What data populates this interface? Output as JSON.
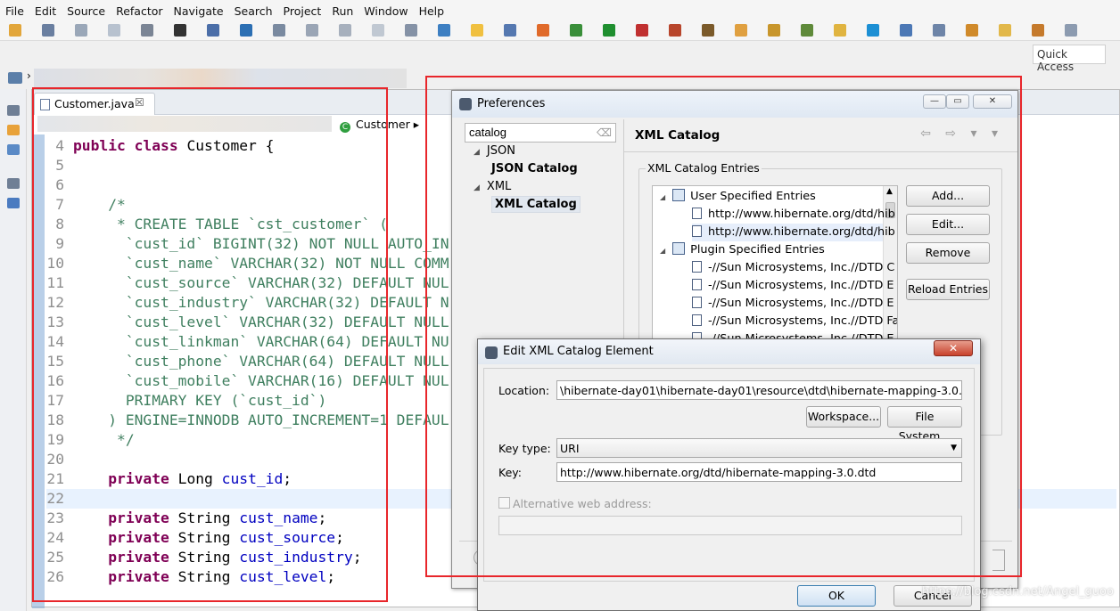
{
  "menubar": [
    "File",
    "Edit",
    "Source",
    "Refactor",
    "Navigate",
    "Search",
    "Project",
    "Run",
    "Window",
    "Help"
  ],
  "quick_access": "Quick Access",
  "editor": {
    "tab_title": "Customer.java",
    "tab_close": "☒",
    "breadcrumb_class": "Customer",
    "lines": [
      {
        "n": "4",
        "parts": [
          [
            "kw",
            "public class "
          ],
          [
            "",
            "Customer {"
          ]
        ]
      },
      {
        "n": "5",
        "parts": []
      },
      {
        "n": "6",
        "parts": []
      },
      {
        "n": "7",
        "parts": [
          [
            "cm",
            "    /*"
          ]
        ]
      },
      {
        "n": "8",
        "parts": [
          [
            "cm",
            "     * CREATE TABLE `cst_customer` ("
          ]
        ]
      },
      {
        "n": "9",
        "parts": [
          [
            "cm",
            "      `cust_id` BIGINT(32) NOT NULL AUTO_IN"
          ]
        ]
      },
      {
        "n": "10",
        "parts": [
          [
            "cm",
            "      `cust_name` VARCHAR(32) NOT NULL COMM"
          ]
        ]
      },
      {
        "n": "11",
        "parts": [
          [
            "cm",
            "      `cust_source` VARCHAR(32) DEFAULT NUL"
          ]
        ]
      },
      {
        "n": "12",
        "parts": [
          [
            "cm",
            "      `cust_industry` VARCHAR(32) DEFAULT N"
          ]
        ]
      },
      {
        "n": "13",
        "parts": [
          [
            "cm",
            "      `cust_level` VARCHAR(32) DEFAULT NULL"
          ]
        ]
      },
      {
        "n": "14",
        "parts": [
          [
            "cm",
            "      `cust_linkman` VARCHAR(64) DEFAULT NU"
          ]
        ]
      },
      {
        "n": "15",
        "parts": [
          [
            "cm",
            "      `cust_phone` VARCHAR(64) DEFAULT NULL"
          ]
        ]
      },
      {
        "n": "16",
        "parts": [
          [
            "cm",
            "      `cust_mobile` VARCHAR(16) DEFAULT NUL"
          ]
        ]
      },
      {
        "n": "17",
        "parts": [
          [
            "cm",
            "      PRIMARY KEY (`cust_id`)"
          ]
        ]
      },
      {
        "n": "18",
        "parts": [
          [
            "cm",
            "    ) ENGINE=INNODB AUTO_INCREMENT=1 DEFAUL"
          ]
        ]
      },
      {
        "n": "19",
        "parts": [
          [
            "cm",
            "     */"
          ]
        ]
      },
      {
        "n": "20",
        "parts": []
      },
      {
        "n": "21",
        "parts": [
          [
            "kw",
            "    private "
          ],
          [
            "",
            "Long "
          ],
          [
            "fld",
            "cust_id"
          ],
          [
            "",
            ";"
          ]
        ]
      },
      {
        "n": "22",
        "parts": [],
        "highlight": true
      },
      {
        "n": "23",
        "parts": [
          [
            "kw",
            "    private "
          ],
          [
            "",
            "String "
          ],
          [
            "fld",
            "cust_name"
          ],
          [
            "",
            ";"
          ]
        ]
      },
      {
        "n": "24",
        "parts": [
          [
            "kw",
            "    private "
          ],
          [
            "",
            "String "
          ],
          [
            "fld",
            "cust_source"
          ],
          [
            "",
            ";"
          ]
        ]
      },
      {
        "n": "25",
        "parts": [
          [
            "kw",
            "    private "
          ],
          [
            "",
            "String "
          ],
          [
            "fld",
            "cust_industry"
          ],
          [
            "",
            ";"
          ]
        ]
      },
      {
        "n": "26",
        "parts": [
          [
            "kw",
            "    private "
          ],
          [
            "",
            "String "
          ],
          [
            "fld",
            "cust_level"
          ],
          [
            "",
            ";"
          ]
        ]
      }
    ]
  },
  "preferences": {
    "title": "Preferences",
    "filter_value": "catalog",
    "tree": [
      {
        "label": "JSON",
        "level": 0
      },
      {
        "label": "JSON Catalog",
        "level": 1,
        "bold": true
      },
      {
        "label": "XML",
        "level": 0
      },
      {
        "label": "XML Catalog",
        "level": 1,
        "bold": true,
        "selected": true
      }
    ],
    "page_title": "XML Catalog",
    "group_label": "XML Catalog Entries",
    "entries": [
      {
        "label": "User Specified Entries",
        "kind": "category"
      },
      {
        "label": "http://www.hibernate.org/dtd/hib",
        "kind": "doc"
      },
      {
        "label": "http://www.hibernate.org/dtd/hib",
        "kind": "doc",
        "selected": true
      },
      {
        "label": "Plugin Specified Entries",
        "kind": "category"
      },
      {
        "label": "-//Sun Microsystems, Inc.//DTD C",
        "kind": "doc"
      },
      {
        "label": "-//Sun Microsystems, Inc.//DTD E",
        "kind": "doc"
      },
      {
        "label": "-//Sun Microsystems, Inc.//DTD E",
        "kind": "doc"
      },
      {
        "label": "-//Sun Microsystems, Inc.//DTD Fa",
        "kind": "doc"
      },
      {
        "label": "-//Sun Microsystems, Inc.//DTD E",
        "kind": "doc"
      }
    ],
    "buttons": {
      "add": "Add...",
      "edit": "Edit...",
      "remove": "Remove",
      "reload": "Reload Entries"
    }
  },
  "edit_dialog": {
    "title": "Edit XML Catalog Element",
    "close": "✕",
    "location_label": "Location:",
    "location_value": "\\hibernate-day01\\hibernate-day01\\resource\\dtd\\hibernate-mapping-3.0.dtd",
    "workspace_btn": "Workspace...",
    "filesystem_btn": "File System...",
    "keytype_label": "Key type:",
    "keytype_value": "URI",
    "key_label": "Key:",
    "key_value": "http://www.hibernate.org/dtd/hibernate-mapping-3.0.dtd",
    "alt_label": "Alternative web address:",
    "ok": "OK",
    "cancel": "Cancel"
  },
  "watermark": "https://blog.csdn.net/Angel_guoo",
  "colors": {
    "annotation": "#e8262b",
    "keyword": "#7f0055",
    "comment": "#3f7f5f",
    "field": "#0000c0"
  }
}
